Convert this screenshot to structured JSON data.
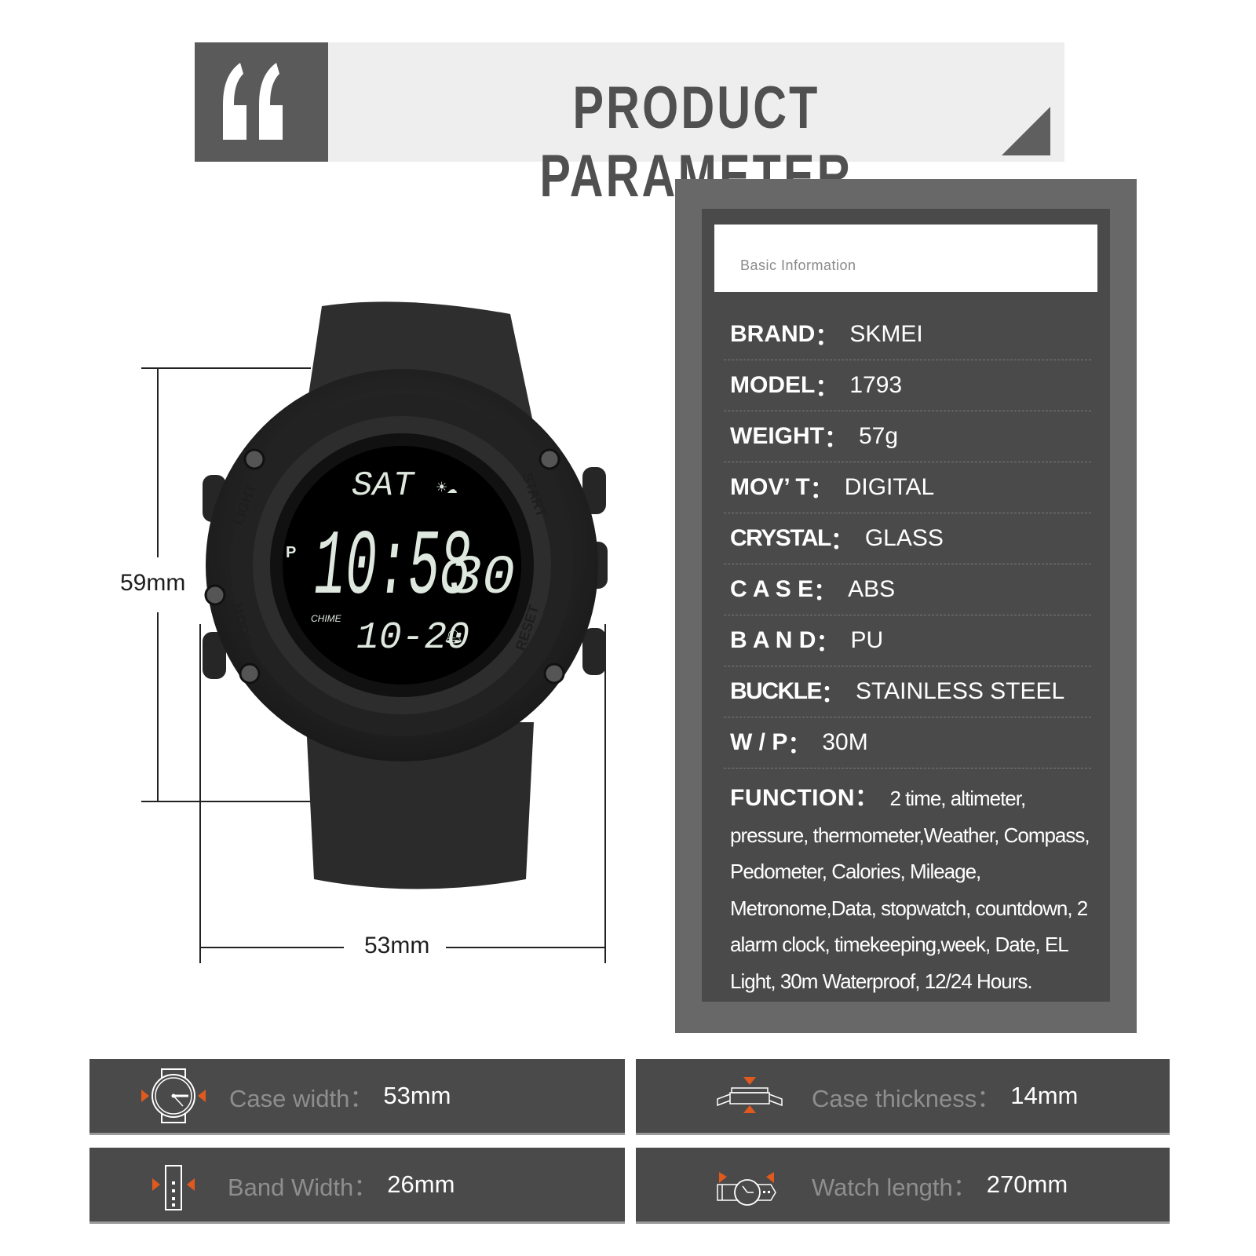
{
  "banner": {
    "title": "PRODUCT PARAMETER",
    "quote_icon": "quote-open-icon"
  },
  "dimensions": {
    "height_label": "59mm",
    "width_label": "53mm"
  },
  "watch_display": {
    "day": "SAT",
    "time": "10:58",
    "seconds": "30",
    "pm_indicator": "P",
    "chime": "CHIME",
    "date": "10-20",
    "button_labels": [
      "LIGHT",
      "MODE",
      "START",
      "RESET"
    ]
  },
  "info": {
    "header": "Basic Information",
    "rows": [
      {
        "key": "BRAND",
        "value": "SKMEI"
      },
      {
        "key": "MODEL",
        "value": "1793"
      },
      {
        "key": "WEIGHT",
        "value": "57g"
      },
      {
        "key": "MOV’ T",
        "value": "DIGITAL"
      },
      {
        "key": "CRYSTAL",
        "value": "GLASS"
      },
      {
        "key": "C A S E",
        "value": "ABS"
      },
      {
        "key": "B A N D",
        "value": "PU"
      },
      {
        "key": "BUCKLE",
        "value": "STAINLESS STEEL"
      },
      {
        "key": "W / P",
        "value": "30M"
      }
    ],
    "function_key": "FUNCTION",
    "function_value": "2 time, altimeter, pressure, thermometer,Weather, Compass, Pedometer, Calories, Mileage, Metronome,Data, stopwatch, countdown, 2 alarm clock, timekeeping,week, Date, EL Light, 30m Waterproof, 12/24 Hours."
  },
  "specs": [
    {
      "label": "Case width：",
      "value": "53mm",
      "icon": "case-width-icon"
    },
    {
      "label": "Case thickness：",
      "value": "14mm",
      "icon": "case-thickness-icon"
    },
    {
      "label": "Band Width：",
      "value": "26mm",
      "icon": "band-width-icon"
    },
    {
      "label": "Watch length：",
      "value": "270mm",
      "icon": "watch-length-icon"
    }
  ],
  "colors": {
    "accent": "#e05a1e",
    "panel_dark": "#4a4a4a",
    "panel_frame": "#686868",
    "banner_bg": "#eeeeee"
  }
}
